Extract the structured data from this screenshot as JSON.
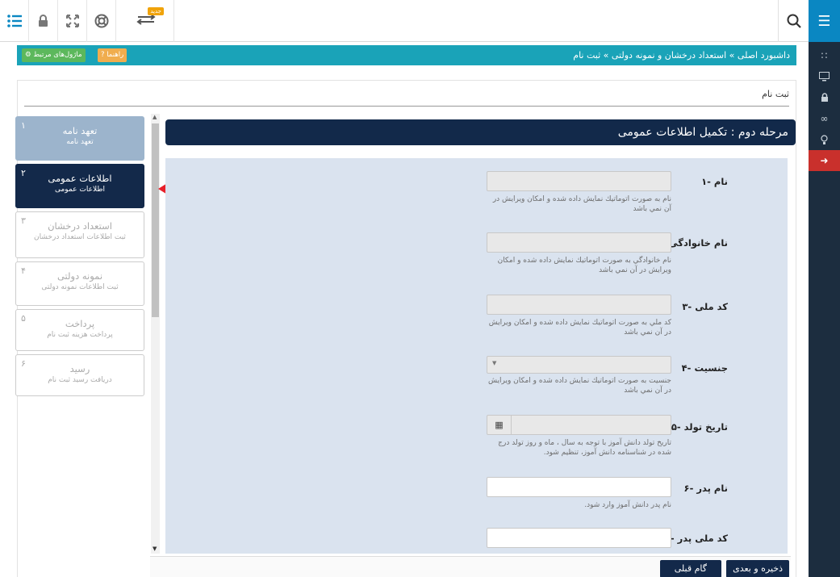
{
  "topbar": {
    "new_badge": "جدید",
    "icons": [
      "list-icon",
      "lock-icon",
      "fullscreen-icon",
      "lifebuoy-icon",
      "swap-icon",
      "search-icon"
    ]
  },
  "sidebar": {
    "icons": [
      "menu-icon",
      "grid-icon",
      "monitor-icon",
      "lock-icon",
      "link-icon",
      "bulb-icon",
      "logout-icon"
    ]
  },
  "breadcrumb": {
    "text": "داشبورد اصلی » استعداد درخشان و نمونه دولتی » ثبت نام",
    "help_label": "راهنما",
    "modules_label": "ماژول‌های مرتبط"
  },
  "page": {
    "title": "ثبت نام",
    "section_title": "مرحله دوم : تکمیل اطلاعات عمومی"
  },
  "steps": [
    {
      "num": "۱",
      "title": "تعهد نامه",
      "subtitle": "تعهد نامه",
      "state": "done"
    },
    {
      "num": "۲",
      "title": "اطلاعات عمومی",
      "subtitle": "اطلاعات عمومی",
      "state": "current"
    },
    {
      "num": "۳",
      "title": "استعداد درخشان",
      "subtitle": "ثبت اطلاعات استعداد درخشان",
      "state": "pending"
    },
    {
      "num": "۴",
      "title": "نمونه دولتی",
      "subtitle": "ثبت اطلاعات نمونه دولتی",
      "state": "pending"
    },
    {
      "num": "۵",
      "title": "پرداخت",
      "subtitle": "پرداخت هزینه ثبت نام",
      "state": "pending"
    },
    {
      "num": "۶",
      "title": "رسید",
      "subtitle": "دریافت رسید ثبت نام",
      "state": "pending"
    }
  ],
  "form": {
    "fields": [
      {
        "label": "۱- نام",
        "hint": "نام به صورت اتوماتیك نمایش داده شده و امكان ویرایش در آن نمي باشد",
        "type": "readonly",
        "value": ""
      },
      {
        "label": "۲- نام خانوادگی",
        "hint": "نام خانوادگي به صورت اتوماتيك نمايش داده شده و امكان ويرايش در آن نمي باشد",
        "type": "readonly",
        "value": ""
      },
      {
        "label": "۳- کد ملی",
        "hint": "كد ملي به صورت اتوماتيك نمايش داده شده و امكان ويرايش در آن نمي باشد",
        "type": "readonly",
        "value": ""
      },
      {
        "label": "۴- جنسیت",
        "hint": "جنسيت به صورت اتوماتيك نمايش داده شده و امكان ويرايش در آن نمي باشد",
        "type": "select",
        "value": ""
      },
      {
        "label": "۵- تاریخ تولد",
        "hint": "تاریخ تولد دانش آموز با توجه به سال ، ماه و روز تولد درج شده در شناسنامه دانش آموز، تنظيم شود.",
        "type": "date",
        "value": ""
      },
      {
        "label": "۶- نام پدر",
        "hint": "نام پدر دانش آموز وارد شود.",
        "type": "text",
        "value": ""
      },
      {
        "label": "۷- کد ملی پدر",
        "hint": "",
        "type": "text",
        "value": ""
      }
    ]
  },
  "buttons": {
    "save_next": "ذخیره و بعدی",
    "prev": "گام قبلی"
  },
  "colors": {
    "sidebar": "#1c2d3f",
    "accent_blue": "#0a87c2",
    "breadcrumb_teal": "#1aa3b8",
    "navy": "#13294a",
    "form_bg": "#dae3ef",
    "danger": "#c9302c",
    "success": "#5cb85c"
  }
}
